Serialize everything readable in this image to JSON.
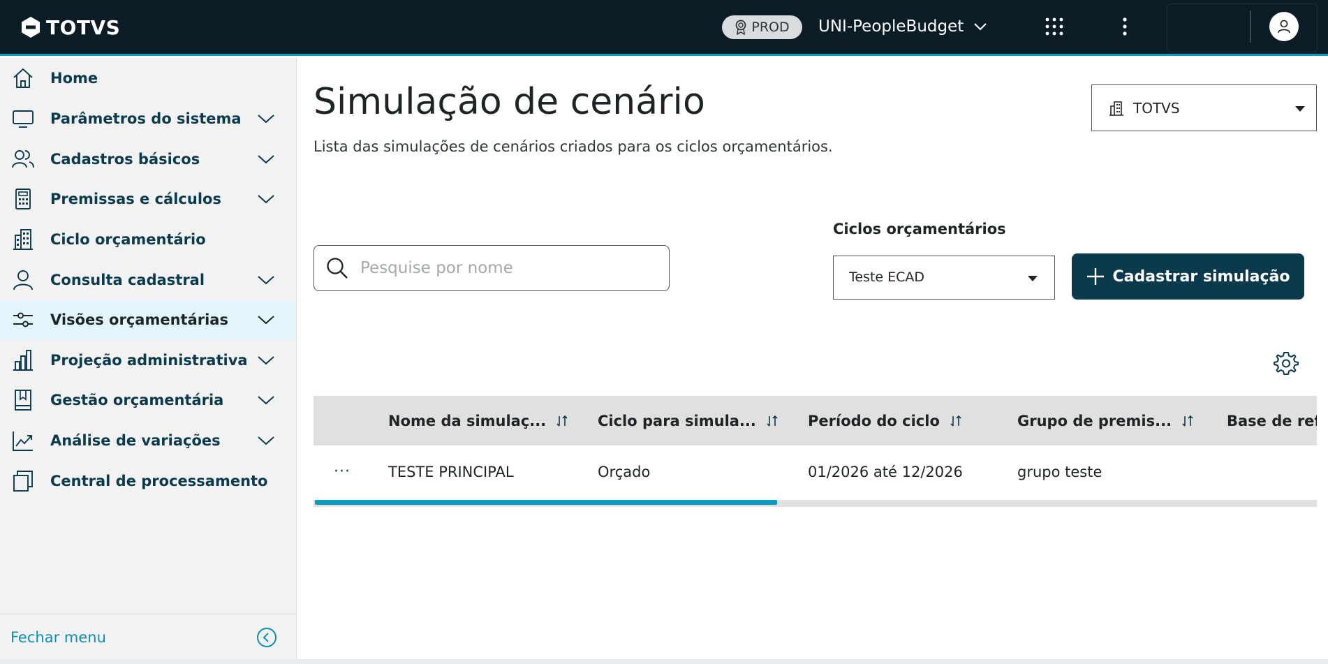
{
  "topbar": {
    "brand": "TOTVS",
    "env": "PROD",
    "app_name": "UNI-PeopleBudget",
    "icons": [
      "totvs-logo-icon",
      "badge-icon",
      "chevron-down-icon",
      "apps-grid-icon",
      "kebab-menu-icon",
      "user-icon"
    ]
  },
  "sidebar": {
    "items": [
      {
        "label": "Home",
        "icon": "home-icon",
        "expandable": false
      },
      {
        "label": "Parâmetros do sistema",
        "icon": "monitor-icon",
        "expandable": true
      },
      {
        "label": "Cadastros básicos",
        "icon": "users-icon",
        "expandable": true
      },
      {
        "label": "Premissas e cálculos",
        "icon": "calculator-icon",
        "expandable": true
      },
      {
        "label": "Ciclo orçamentário",
        "icon": "building-icon",
        "expandable": false
      },
      {
        "label": "Consulta cadastral",
        "icon": "user-icon",
        "expandable": true
      },
      {
        "label": "Visões orçamentárias",
        "icon": "sliders-icon",
        "expandable": true,
        "active": true
      },
      {
        "label": "Projeção administrativa",
        "icon": "bar-chart-icon",
        "expandable": true
      },
      {
        "label": "Gestão orçamentária",
        "icon": "bookmark-icon",
        "expandable": true
      },
      {
        "label": "Análise de variações",
        "icon": "trend-icon",
        "expandable": true
      },
      {
        "label": "Central de processamento",
        "icon": "copy-icon",
        "expandable": false
      }
    ],
    "close_label": "Fechar menu"
  },
  "main": {
    "title": "Simulação de cenário",
    "subtitle": "Lista das simulações de cenários criados para os ciclos orçamentários.",
    "company_select": {
      "value": "TOTVS"
    },
    "search": {
      "placeholder": "Pesquise por nome",
      "value": ""
    },
    "cycle": {
      "label": "Ciclos orçamentários",
      "value": "Teste ECAD"
    },
    "add_button": "Cadastrar simulação",
    "table": {
      "columns": [
        "Nome da simulaç...",
        "Ciclo para simula...",
        "Período do ciclo",
        "Grupo de premis...",
        "Base de ref"
      ],
      "rows": [
        {
          "actions": "···",
          "cells": [
            "TESTE PRINCIPAL",
            "Orçado",
            "01/2026 até 12/2026",
            "grupo teste",
            ""
          ]
        }
      ],
      "scroll_position": 0.46
    }
  },
  "colors": {
    "topbar": "#0b1c27",
    "accent": "#0c9abe",
    "primary": "#0b3a4c",
    "active_menu": "#e2f5fb"
  }
}
